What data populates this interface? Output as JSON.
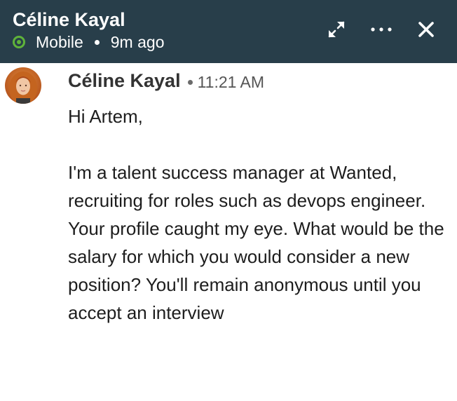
{
  "header": {
    "name": "Céline Kayal",
    "presence_status": "Mobile",
    "last_active": "9m ago",
    "icons": {
      "presence": "online-dot-icon",
      "expand": "expand-icon",
      "more": "more-options-icon",
      "close": "close-icon"
    }
  },
  "message": {
    "sender": "Céline Kayal",
    "time": "11:21 AM",
    "greeting": "Hi Artem,",
    "body": "I'm a talent success manager at Wanted, recruiting for roles such as devops engineer. Your profile caught my eye. What would be the salary for which you would consider a new position? You'll remain anonymous until you accept an interview"
  },
  "colors": {
    "header_bg": "#283e4a",
    "online": "#5fb33a"
  }
}
